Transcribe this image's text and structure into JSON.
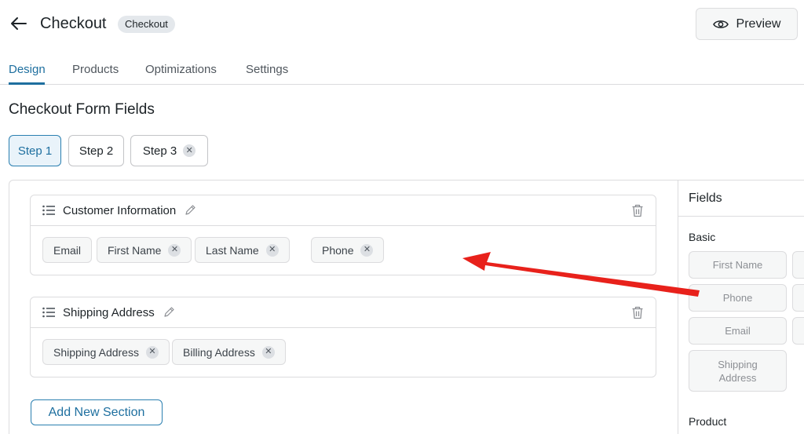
{
  "header": {
    "title": "Checkout",
    "badge": "Checkout",
    "preview_label": "Preview"
  },
  "tabs": [
    {
      "label": "Design",
      "active": true
    },
    {
      "label": "Products",
      "active": false
    },
    {
      "label": "Optimizations",
      "active": false
    },
    {
      "label": "Settings",
      "active": false
    }
  ],
  "section_title": "Checkout Form Fields",
  "steps": [
    {
      "label": "Step 1",
      "active": true
    },
    {
      "label": "Step 2",
      "active": false
    },
    {
      "label": "Step 3",
      "active": false,
      "removable": true
    }
  ],
  "sections": [
    {
      "title": "Customer Information",
      "fields": [
        {
          "label": "Email",
          "removable": false
        },
        {
          "label": "First Name",
          "removable": true
        },
        {
          "label": "Last Name",
          "removable": true
        },
        {
          "label": "Phone",
          "removable": true
        }
      ]
    },
    {
      "title": "Shipping Address",
      "fields": [
        {
          "label": "Shipping Address",
          "removable": true
        },
        {
          "label": "Billing Address",
          "removable": true
        }
      ]
    }
  ],
  "add_section_label": "Add New Section",
  "fields_panel": {
    "title": "Fields",
    "groups": [
      {
        "label": "Basic",
        "items": [
          "First Name",
          "Phone",
          "Email",
          "Shipping Address"
        ]
      },
      {
        "label": "Product",
        "items": []
      }
    ]
  },
  "colors": {
    "accent": "#1e6f9f",
    "annotation_arrow": "#e8211b"
  },
  "icons": {
    "back": "arrow-left-icon",
    "preview": "eye-icon",
    "drag": "drag-handle-icon",
    "edit": "pencil-icon",
    "delete": "trash-icon",
    "remove": "close-icon"
  }
}
